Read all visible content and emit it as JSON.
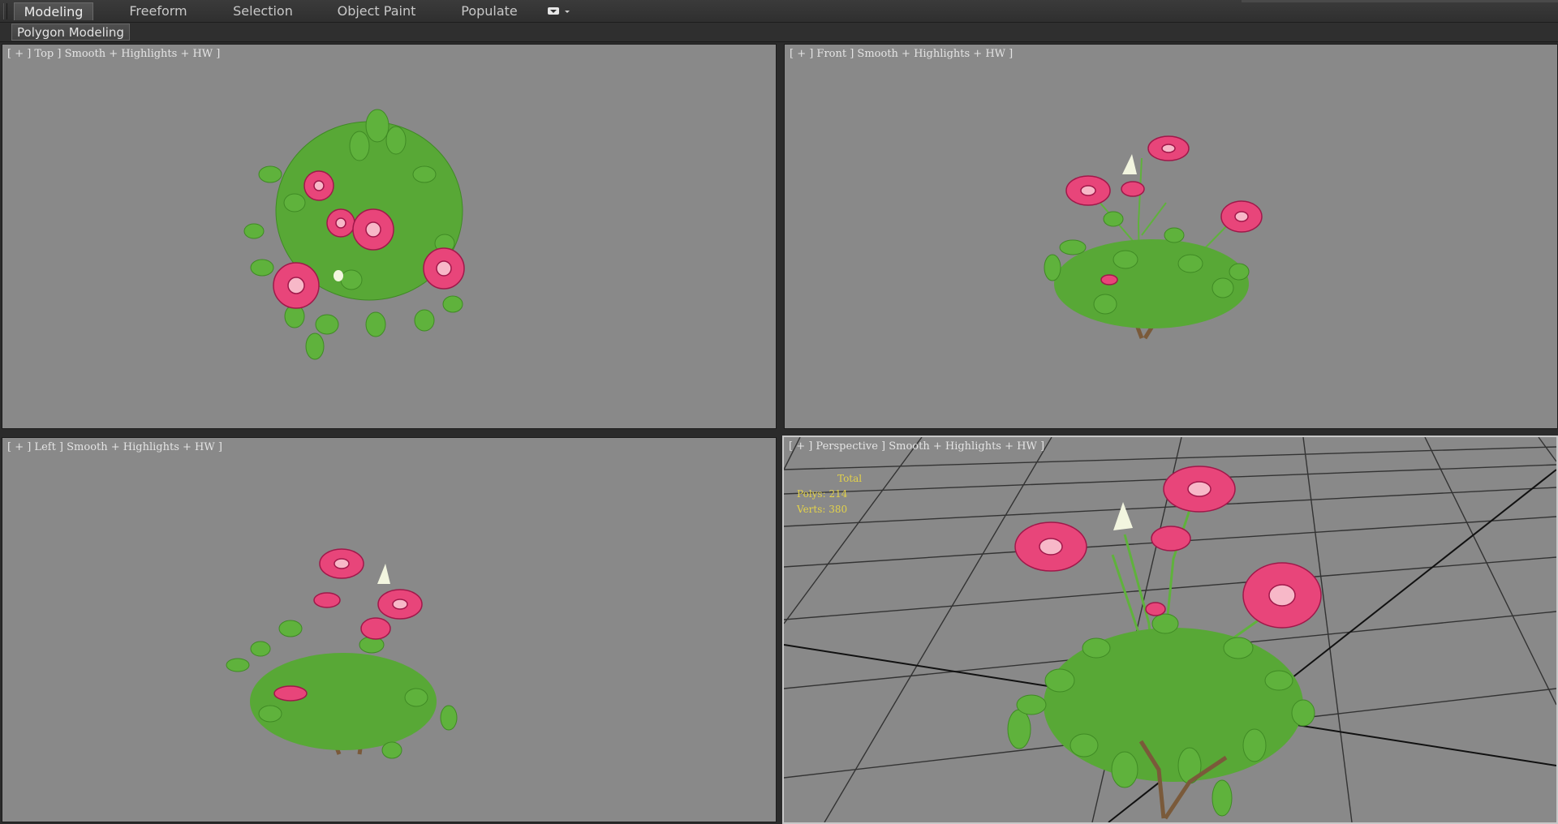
{
  "ribbon": {
    "tabs": [
      {
        "label": "Modeling",
        "active": true
      },
      {
        "label": "Freeform",
        "active": false
      },
      {
        "label": "Selection",
        "active": false
      },
      {
        "label": "Object Paint",
        "active": false
      },
      {
        "label": "Populate",
        "active": false
      }
    ],
    "panel_label": "Polygon Modeling"
  },
  "viewports": {
    "top": {
      "label": "[ + ] Top ] Smooth + Highlights + HW ]"
    },
    "front": {
      "label": "[ + ] Front ] Smooth + Highlights + HW ]"
    },
    "left": {
      "label": "[ + ] Left ] Smooth + Highlights + HW ]"
    },
    "perspective": {
      "label": "[ + ] Perspective ] Smooth + Highlights + HW ]",
      "stats": {
        "header": "Total",
        "polys": "Polys: 214",
        "verts": "Verts: 380"
      }
    }
  },
  "colors": {
    "viewport_bg": "#898989",
    "stats_text": "#e3d24a",
    "leaf": "#5fb23c",
    "flower": "#e8457a",
    "bud": "#f2f5df",
    "stem": "#7a5a3a",
    "active_viewport_border": "#c8c8c8"
  }
}
